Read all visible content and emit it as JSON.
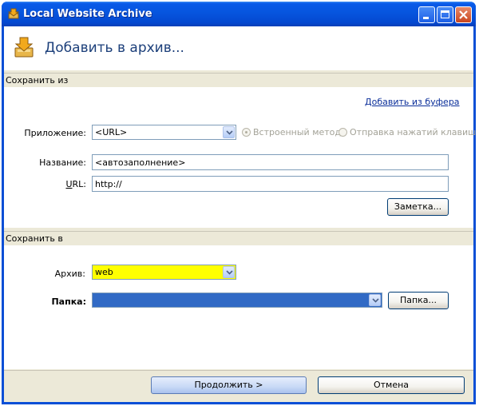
{
  "window": {
    "title": "Local Website Archive"
  },
  "header": {
    "title": "Добавить в архив..."
  },
  "save_from": {
    "section_label": "Сохранить из",
    "clipboard_link": "Добавить из буфера",
    "app_label": "Приложение:",
    "app_value": "<URL>",
    "radio_builtin": "Встроенный метод",
    "radio_keystrokes": "Отправка нажатий клавиш",
    "name_label": "Название:",
    "name_value": "<автозаполнение>",
    "url_label": "URL:",
    "url_value": "http://",
    "note_button": "Заметка..."
  },
  "save_to": {
    "section_label": "Сохранить в",
    "archive_label": "Архив:",
    "archive_value": "web",
    "folder_label": "Папка:",
    "folder_value": "",
    "folder_button": "Папка..."
  },
  "footer": {
    "continue_button": "Продолжить >",
    "cancel_button": "Отмена"
  },
  "colors": {
    "archive_highlight": "#ffff00",
    "folder_selected": "#316ac5",
    "title_bar": "#0655de"
  }
}
